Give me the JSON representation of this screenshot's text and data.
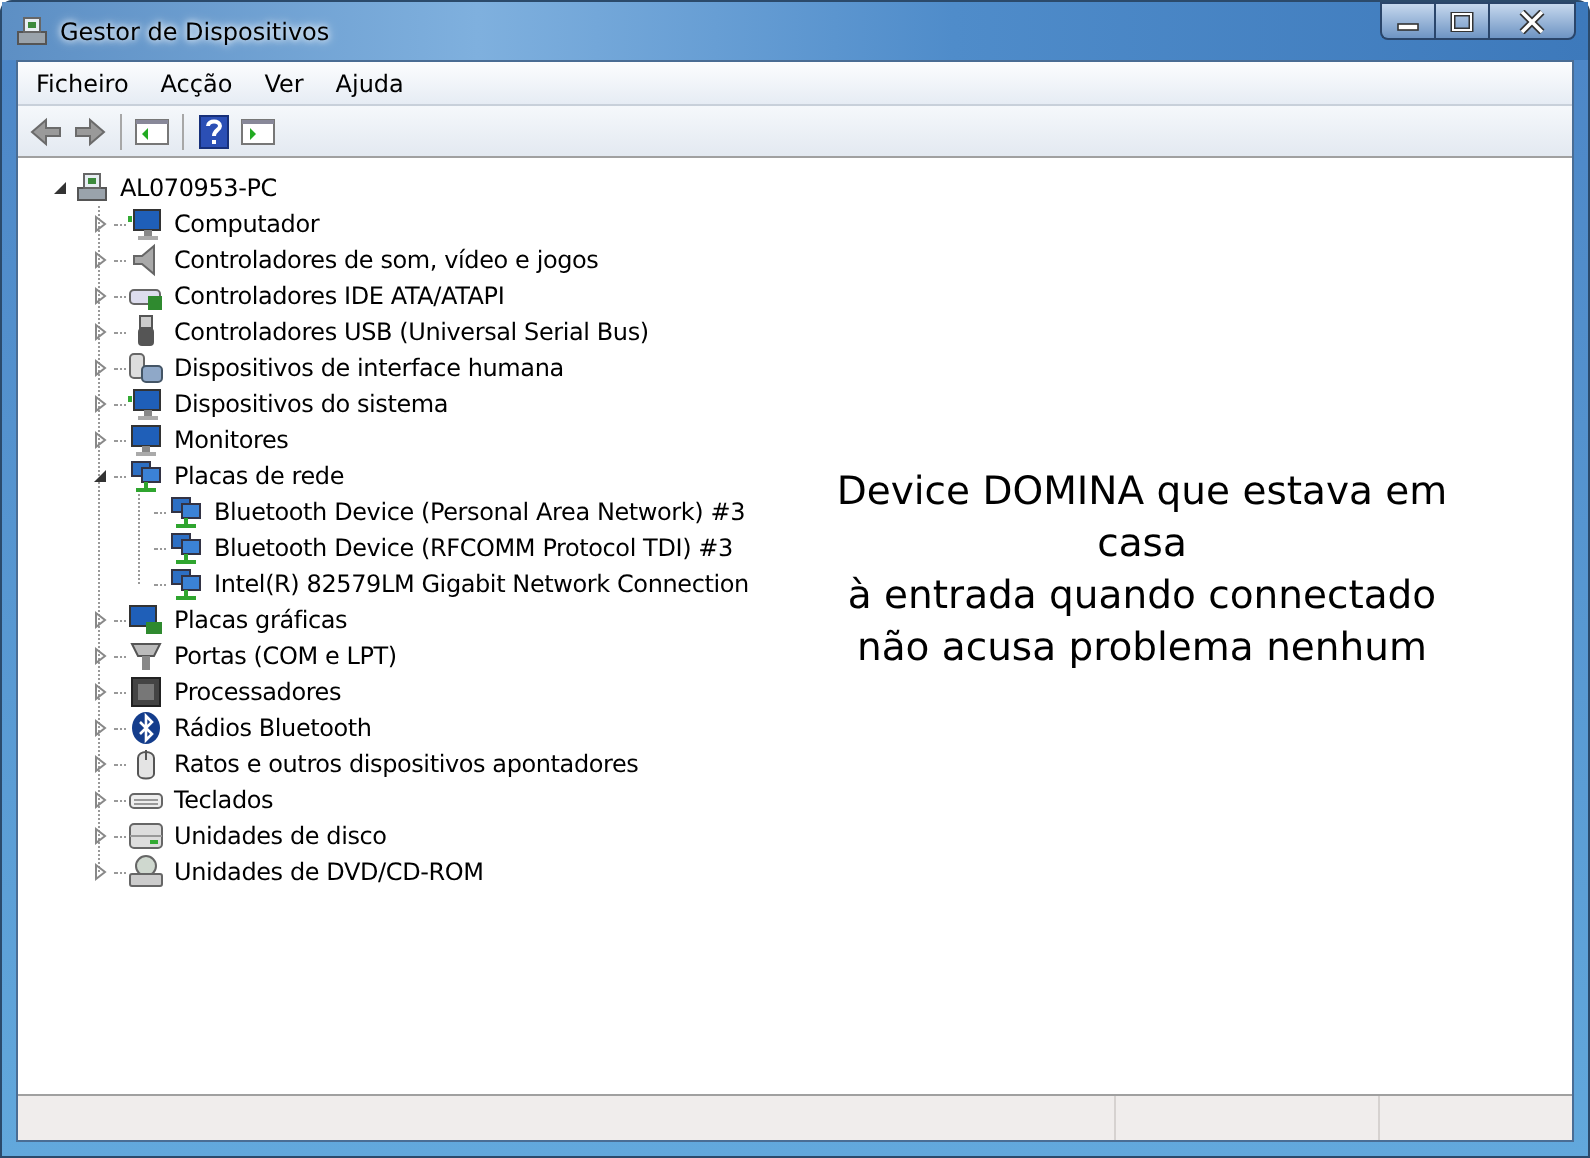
{
  "window": {
    "title": "Gestor de Dispositivos"
  },
  "menu": [
    "Ficheiro",
    "Acção",
    "Ver",
    "Ajuda"
  ],
  "toolbar": [
    {
      "kind": "back"
    },
    {
      "kind": "forward"
    },
    {
      "kind": "separator"
    },
    {
      "kind": "console-tree"
    },
    {
      "kind": "separator"
    },
    {
      "kind": "help"
    },
    {
      "kind": "action-pane"
    }
  ],
  "tree": [
    {
      "label": "AL070953-PC",
      "kind": "pc",
      "expanded": true,
      "children": [
        {
          "label": "Computador",
          "kind": "computer",
          "expanded": false
        },
        {
          "label": "Controladores de som, vídeo e jogos",
          "kind": "speaker",
          "expanded": false
        },
        {
          "label": "Controladores IDE ATA/ATAPI",
          "kind": "ide",
          "expanded": false
        },
        {
          "label": "Controladores USB (Universal Serial Bus)",
          "kind": "usb",
          "expanded": false
        },
        {
          "label": "Dispositivos de interface humana",
          "kind": "hid",
          "expanded": false
        },
        {
          "label": "Dispositivos do sistema",
          "kind": "computer",
          "expanded": false
        },
        {
          "label": "Monitores",
          "kind": "monitor",
          "expanded": false
        },
        {
          "label": "Placas de rede",
          "kind": "network",
          "expanded": true,
          "children": [
            {
              "label": "Bluetooth Device (Personal Area Network) #3",
              "kind": "network"
            },
            {
              "label": "Bluetooth Device (RFCOMM Protocol TDI) #3",
              "kind": "network"
            },
            {
              "label": "Intel(R) 82579LM Gigabit Network Connection",
              "kind": "network"
            }
          ]
        },
        {
          "label": "Placas gráficas",
          "kind": "display",
          "expanded": false
        },
        {
          "label": "Portas (COM e LPT)",
          "kind": "port",
          "expanded": false
        },
        {
          "label": "Processadores",
          "kind": "cpu",
          "expanded": false
        },
        {
          "label": "Rádios Bluetooth",
          "kind": "bluetooth",
          "expanded": false
        },
        {
          "label": "Ratos e outros dispositivos apontadores",
          "kind": "mouse",
          "expanded": false
        },
        {
          "label": "Teclados",
          "kind": "keyboard",
          "expanded": false
        },
        {
          "label": "Unidades de disco",
          "kind": "disk",
          "expanded": false
        },
        {
          "label": "Unidades de DVD/CD-ROM",
          "kind": "dvd",
          "expanded": false
        }
      ]
    }
  ],
  "annotation": "Device DOMINA que estava em\ncasa\nà entrada quando connectado\nnão acusa problema nenhum"
}
